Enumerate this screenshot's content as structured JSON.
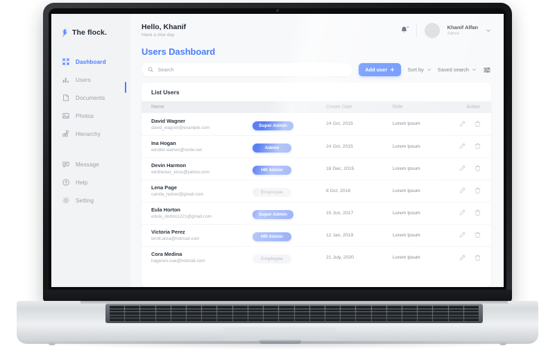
{
  "brand": {
    "logo_icon": "flock-lightning-icon",
    "name": "The flock.",
    "accent": "#4a7dfc"
  },
  "sidebar": {
    "items": [
      {
        "label": "Dashboard",
        "icon": "dashboard-grid-icon",
        "active": true
      },
      {
        "label": "Users",
        "icon": "bar-chart-icon",
        "active": false
      },
      {
        "label": "Documents",
        "icon": "document-icon",
        "active": false
      },
      {
        "label": "Photos",
        "icon": "photo-icon",
        "active": false
      },
      {
        "label": "Hierarchy",
        "icon": "hierarchy-icon",
        "active": false
      },
      {
        "label": "Message",
        "icon": "message-icon",
        "active": false
      },
      {
        "label": "Help",
        "icon": "help-circle-icon",
        "active": false
      },
      {
        "label": "Setting",
        "icon": "gear-icon",
        "active": false
      }
    ]
  },
  "topbar": {
    "greeting": "Hello, Khanif",
    "subtitle": "Have a nice day",
    "bell_icon": "notification-bell-icon",
    "user": {
      "name": "Khanif Alfan",
      "role": "Admin",
      "avatar_icon": "avatar-placeholder"
    },
    "caret_icon": "chevron-down-icon"
  },
  "page": {
    "title": "Users Dashboard"
  },
  "toolbar": {
    "search_placeholder": "Search",
    "search_value": "",
    "search_icon": "search-icon",
    "add_user_label": "Add user",
    "add_user_icon": "plus-icon",
    "sort_by_label": "Sort by",
    "saved_search_label": "Saved search",
    "chevron_icon": "chevron-down-icon",
    "filter_icon": "filter-sliders-icon"
  },
  "table": {
    "card_title": "List Users",
    "columns": [
      "Name",
      "",
      "Create Date",
      "Role",
      "Action"
    ],
    "action_icons": {
      "edit": "pencil-edit-icon",
      "delete": "trash-delete-icon"
    },
    "rows": [
      {
        "name": "David Wagner",
        "email": "david_wagner@example.com",
        "badge": "Super Admin",
        "badge_style": "blue",
        "date": "24 Oct, 2015",
        "role": "Lorem Ipsum"
      },
      {
        "name": "Ina Hogan",
        "email": "windler.warren@runte.net",
        "badge": "Admin",
        "badge_style": "blue",
        "date": "24 Oct, 2015",
        "role": "Lorem Ipsum"
      },
      {
        "name": "Devin Harmon",
        "email": "wintheiser_enos@yahoo.com",
        "badge": "HR Admin",
        "badge_style": "blue",
        "date": "18 Dec, 2015",
        "role": "Lorem Ipsum"
      },
      {
        "name": "Lena Page",
        "email": "camila_ledner@gmail.com",
        "badge": "Employee",
        "badge_style": "gray",
        "date": "8 Oct, 2016",
        "role": "Lorem Ipsum"
      },
      {
        "name": "Eula Horton",
        "email": "edula_dorton1221@gmail.com",
        "badge": "Super Admin",
        "badge_style": "blue",
        "date": "15 Jun, 2017",
        "role": "Lorem Ipsum"
      },
      {
        "name": "Victoria Perez",
        "email": "terrill.wiza@hotmail.com",
        "badge": "HR Admin",
        "badge_style": "blue",
        "date": "12 Jan, 2019",
        "role": "Lorem Ipsum"
      },
      {
        "name": "Cora Medina",
        "email": "hagenes.sue@hotmail.com",
        "badge": "Employee",
        "badge_style": "gray",
        "date": "21 July, 2020",
        "role": "Lorem Ipsum"
      }
    ]
  }
}
